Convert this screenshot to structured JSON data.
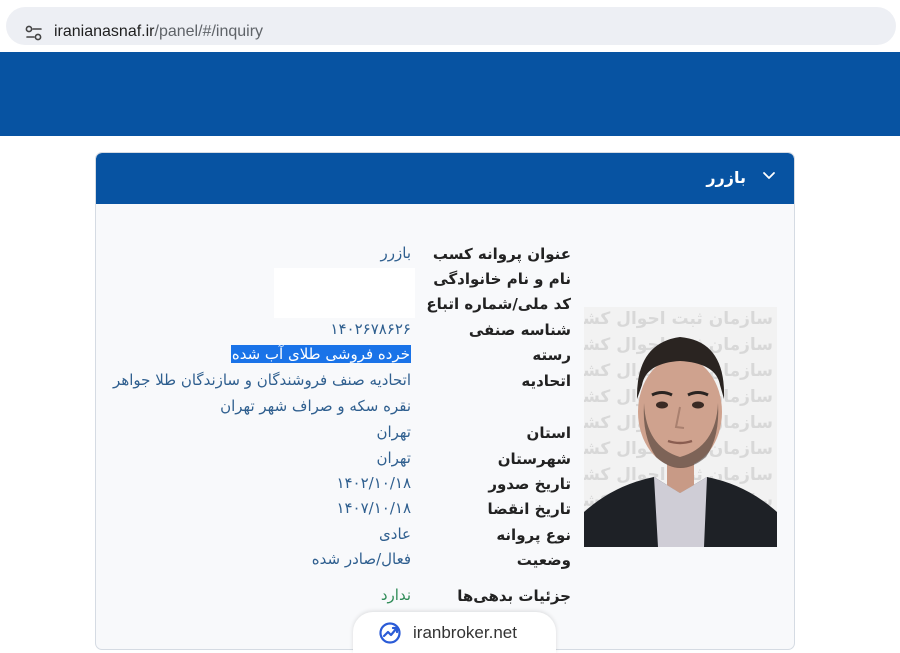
{
  "browser": {
    "url_host": "iranianasnaf.ir",
    "url_path": "/panel/#/inquiry"
  },
  "card": {
    "title": "بازرر",
    "fields": {
      "license_title": {
        "label": "عنوان پروانه کسب",
        "value": "بازرر"
      },
      "full_name": {
        "label": "نام و نام خانوادگی",
        "value": ""
      },
      "national_code": {
        "label": "کد ملی/شماره اتباع",
        "value": ""
      },
      "guild_id": {
        "label": "شناسه صنفی",
        "value": "۱۴۰۲۶۷۸۶۲۶"
      },
      "category": {
        "label": "رسته",
        "value": "خرده فروشی طلای آب شده"
      },
      "union": {
        "label": "اتحادیه",
        "value_line1": "اتحادیه صنف فروشندگان و سازندگان طلا جواهر",
        "value_line2": "نقره سکه و صراف شهر تهران"
      },
      "province": {
        "label": "استان",
        "value": "تهران"
      },
      "city": {
        "label": "شهرستان",
        "value": "تهران"
      },
      "issue_date": {
        "label": "تاریخ صدور",
        "value": "۱۴۰۲/۱۰/۱۸"
      },
      "expiry_date": {
        "label": "تاریخ انقضا",
        "value": "۱۴۰۷/۱۰/۱۸"
      },
      "license_type": {
        "label": "نوع پروانه",
        "value": "عادی"
      },
      "status": {
        "label": "وضعیت",
        "value": "فعال/صادر شده"
      },
      "debts": {
        "label": "جزئیات بدهی‌ها",
        "value": "ندارد"
      }
    },
    "photo_watermark": "سازمان ثبت احوال کشور"
  },
  "brand": {
    "text": "iranbroker.net"
  },
  "colors": {
    "primary_blue": "#0753a2",
    "value_blue": "#2f5f8f",
    "highlight": "#1a73e8",
    "green": "#2e8b57"
  },
  "icons": {
    "address_bar": "site-settings-icon",
    "card_header": "chevron-down-icon",
    "brand": "trend-chart-icon"
  }
}
